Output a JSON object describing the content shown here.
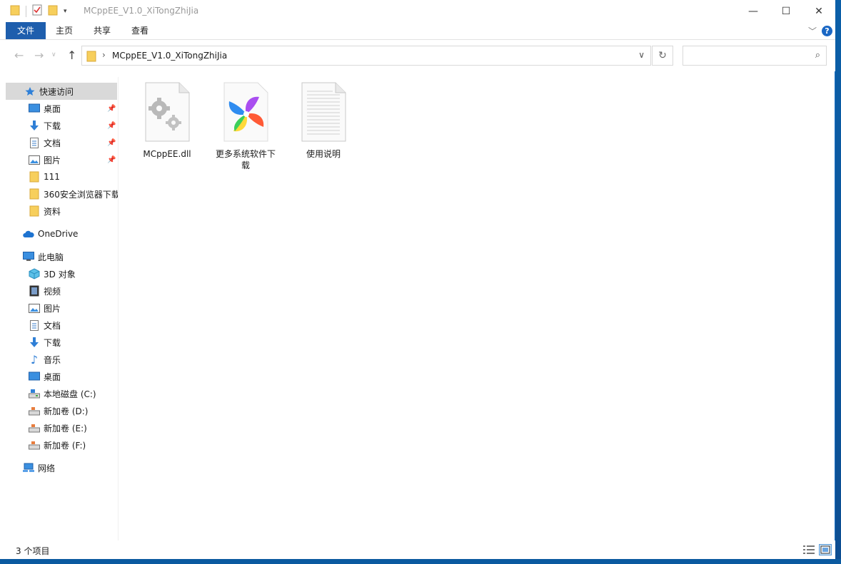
{
  "window": {
    "title": "MCppEE_V1.0_XiTongZhiJia",
    "minimize_glyph": "—",
    "maximize_glyph": "☐",
    "close_glyph": "✕"
  },
  "ribbon": {
    "tabs": [
      "文件",
      "主页",
      "共享",
      "查看"
    ],
    "help_glyph": "?"
  },
  "address": {
    "path": "MCppEE_V1.0_XiTongZhiJia",
    "search_placeholder": ""
  },
  "sidebar": {
    "quick_access": "快速访问",
    "pinned": [
      "桌面",
      "下载",
      "文档",
      "图片"
    ],
    "folders": [
      "111",
      "360安全浏览器下载",
      "资料"
    ],
    "onedrive": "OneDrive",
    "this_pc": "此电脑",
    "pc_items": [
      "3D 对象",
      "视频",
      "图片",
      "文档",
      "下载",
      "音乐",
      "桌面",
      "本地磁盘 (C:)",
      "新加卷 (D:)",
      "新加卷 (E:)",
      "新加卷 (F:)"
    ],
    "network": "网络"
  },
  "files": [
    {
      "name": "MCppEE.dll",
      "icon": "dll-gear-icon"
    },
    {
      "name": "更多系统软件下载",
      "icon": "pinwheel-app-icon"
    },
    {
      "name": "使用说明",
      "icon": "text-document-icon"
    }
  ],
  "status": {
    "item_count": "3 个项目"
  },
  "colors": {
    "accent": "#1e5ead",
    "selection": "#d9d9d9",
    "folder": "#f5c542"
  }
}
